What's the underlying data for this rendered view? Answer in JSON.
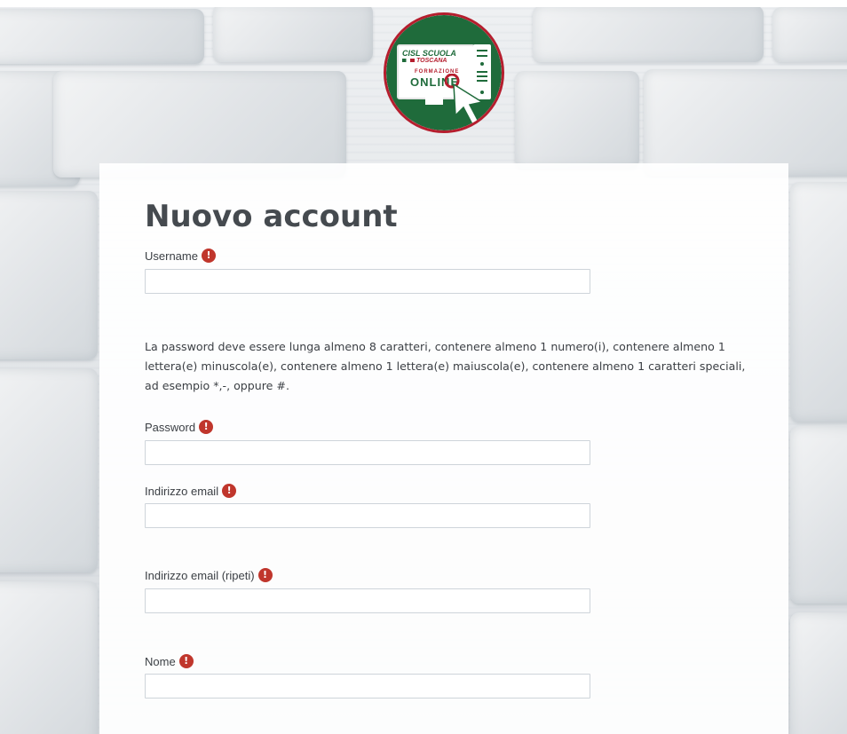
{
  "logo": {
    "line1": "CISL SCUOLA",
    "line2": "TOSCANA",
    "line3": "FORMAZIONE",
    "line4": "ONLINE"
  },
  "form": {
    "title": "Nuovo account",
    "username_label": "Username",
    "username_value": "",
    "password_policy": "La password deve essere lunga almeno 8 caratteri, contenere almeno 1 numero(i), contenere almeno 1 lettera(e) minuscola(e), contenere almeno 1 lettera(e) maiuscola(e), contenere almeno 1 caratteri speciali, ad esempio *,-, oppure #.",
    "password_label": "Password",
    "password_value": "",
    "email_label": "Indirizzo email",
    "email_value": "",
    "email_repeat_label": "Indirizzo email (ripeti)",
    "email_repeat_value": "",
    "nome_label": "Nome",
    "nome_value": "",
    "required_glyph": "!"
  },
  "colors": {
    "brand_green": "#1f6b3b",
    "brand_red": "#b51e2e",
    "required_icon": "#c0362c",
    "title_text": "#454a4f"
  }
}
